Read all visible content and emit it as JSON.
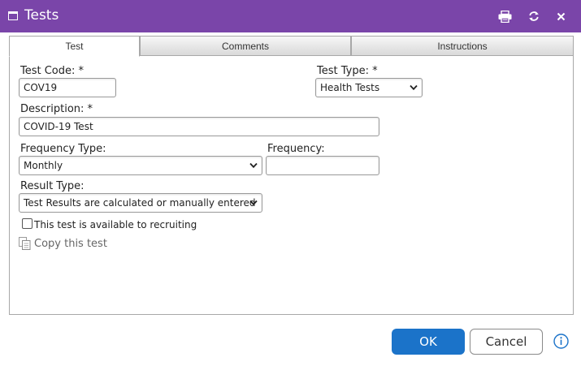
{
  "window": {
    "title": "Tests",
    "titlebar_color": "#7a45a9",
    "icons": [
      "window-icon",
      "print-icon",
      "refresh-icon",
      "close-icon"
    ]
  },
  "tabs": [
    {
      "label": "Test",
      "active": true
    },
    {
      "label": "Comments",
      "active": false
    },
    {
      "label": "Instructions",
      "active": false
    }
  ],
  "form": {
    "test_code": {
      "label": "Test Code: *",
      "value": "COV19"
    },
    "test_type": {
      "label": "Test Type: *",
      "selected": "Health Tests"
    },
    "description": {
      "label": "Description: *",
      "value": "COVID-19 Test"
    },
    "frequency_type": {
      "label": "Frequency Type:",
      "selected": "Monthly"
    },
    "frequency": {
      "label": "Frequency:",
      "value": ""
    },
    "result_type": {
      "label": "Result Type:",
      "selected": "Test Results are calculated or manually entered"
    },
    "recruiting_checkbox": {
      "label": "This test is available to recruiting",
      "checked": false
    },
    "copy_link": {
      "label": "Copy this test",
      "icon": "copy-document-icon"
    }
  },
  "footer": {
    "ok_label": "OK",
    "cancel_label": "Cancel",
    "ok_color": "#1b73c9",
    "info_icon": "info-icon"
  }
}
